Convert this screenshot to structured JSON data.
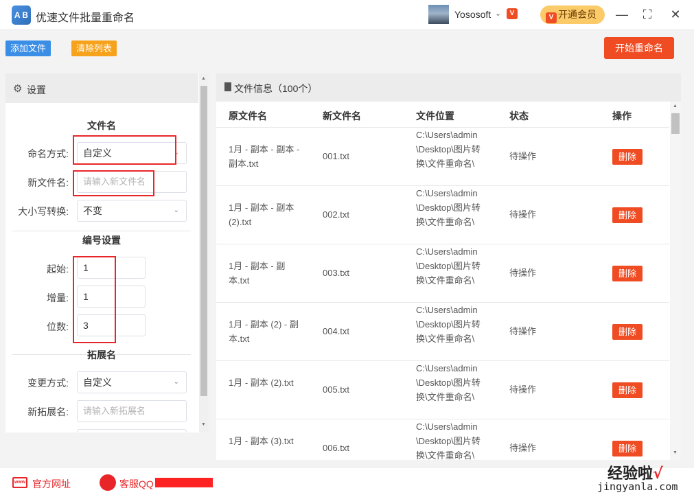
{
  "app": {
    "logo_text": "A B",
    "title": "优速文件批量重命名"
  },
  "user": {
    "name": "Yososoft",
    "vip_button": "开通会员"
  },
  "window_controls": {
    "minimize": "—",
    "maximize": "⛶",
    "close": "✕"
  },
  "toolbar": {
    "add_label": "添加文件",
    "clear_label": "清除列表",
    "start_label": "开始重命名"
  },
  "settings": {
    "title": "设置",
    "filename_section": "文件名",
    "naming_label": "命名方式:",
    "naming_value": "自定义",
    "newname_label": "新文件名:",
    "newname_placeholder": "请输入新文件名",
    "case_label": "大小写转换:",
    "case_value": "不变",
    "number_section": "编号设置",
    "start_label": "起始:",
    "start_value": "1",
    "step_label": "增量:",
    "step_value": "1",
    "digits_label": "位数:",
    "digits_value": "3",
    "ext_section": "拓展名",
    "ext_mode_label": "变更方式:",
    "ext_mode_value": "自定义",
    "new_ext_label": "新拓展名:",
    "new_ext_placeholder": "请输入新拓展名"
  },
  "files": {
    "title": "文件信息（100个）",
    "columns": [
      "原文件名",
      "新文件名",
      "文件位置",
      "状态",
      "操作"
    ],
    "rows": [
      {
        "orig": "1月 - 副本 - 副本 - 副本.txt",
        "new": "001.txt",
        "location": "C:\\Users\\admin\\Desktop\\图片转换\\文件重命名\\",
        "status": "待操作",
        "action": "删除"
      },
      {
        "orig": "1月 - 副本 - 副本 (2).txt",
        "new": "002.txt",
        "location": "C:\\Users\\admin\\Desktop\\图片转换\\文件重命名\\",
        "status": "待操作",
        "action": "删除"
      },
      {
        "orig": "1月 - 副本 - 副本.txt",
        "new": "003.txt",
        "location": "C:\\Users\\admin\\Desktop\\图片转换\\文件重命名\\",
        "status": "待操作",
        "action": "删除"
      },
      {
        "orig": "1月 - 副本 (2) - 副本.txt",
        "new": "004.txt",
        "location": "C:\\Users\\admin\\Desktop\\图片转换\\文件重命名\\",
        "status": "待操作",
        "action": "删除"
      },
      {
        "orig": "1月 - 副本 (2).txt",
        "new": "005.txt",
        "location": "C:\\Users\\admin\\Desktop\\图片转换\\文件重命名\\",
        "status": "待操作",
        "action": "删除"
      },
      {
        "orig": "1月 - 副本 (3).txt",
        "new": "006.txt",
        "location": "C:\\Users\\admin\\Desktop\\图片转换\\文件重命名\\",
        "status": "待操作",
        "action": "删除"
      }
    ]
  },
  "footer": {
    "website": "官方网址",
    "qq": "客服QQ"
  },
  "watermark": {
    "text": "经验啦",
    "check": "√",
    "url": "jingyanla.com"
  },
  "colors": {
    "accent_red": "#f04c23",
    "blue": "#3a8ee6",
    "orange": "#f7a21b",
    "highlight": "#e8262a"
  }
}
